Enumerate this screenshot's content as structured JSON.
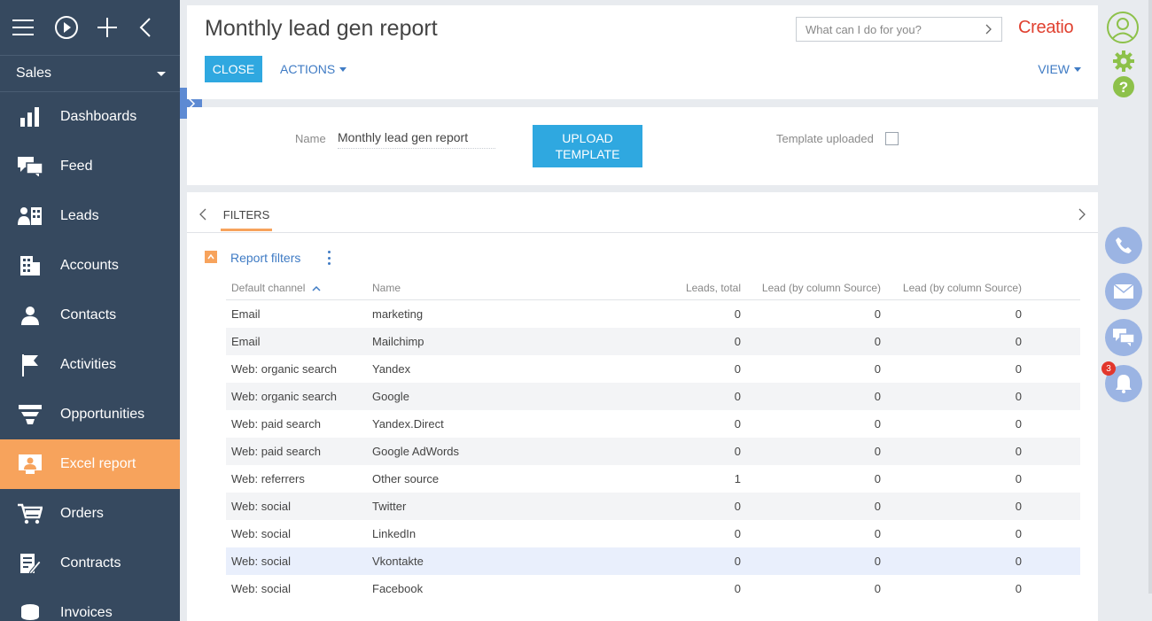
{
  "sidebar": {
    "workspace": "Sales",
    "items": [
      {
        "label": "Dashboards",
        "icon": "bar-chart-icon",
        "active": false
      },
      {
        "label": "Feed",
        "icon": "feed-icon",
        "active": false
      },
      {
        "label": "Leads",
        "icon": "leads-icon",
        "active": false
      },
      {
        "label": "Accounts",
        "icon": "accounts-icon",
        "active": false
      },
      {
        "label": "Contacts",
        "icon": "contacts-icon",
        "active": false
      },
      {
        "label": "Activities",
        "icon": "flag-icon",
        "active": false
      },
      {
        "label": "Opportunities",
        "icon": "funnel-icon",
        "active": false
      },
      {
        "label": "Excel report",
        "icon": "excel-report-icon",
        "active": true
      },
      {
        "label": "Orders",
        "icon": "cart-icon",
        "active": false
      },
      {
        "label": "Contracts",
        "icon": "contract-icon",
        "active": false
      },
      {
        "label": "Invoices",
        "icon": "invoice-icon",
        "active": false
      }
    ]
  },
  "header": {
    "title": "Monthly lead gen report",
    "close_label": "CLOSE",
    "actions_label": "ACTIONS",
    "view_label": "VIEW",
    "search_placeholder": "What can I do for you?",
    "logo": "Creatio"
  },
  "form": {
    "name_label": "Name",
    "name_value": "Monthly lead gen report",
    "upload_line1": "UPLOAD",
    "upload_line2": "TEMPLATE",
    "template_label": "Template uploaded",
    "template_checked": false
  },
  "filters": {
    "tab_label": "FILTERS",
    "group_title": "Report filters",
    "columns": [
      "Default channel",
      "Name",
      "Leads, total",
      "Lead (by column Source)",
      "Lead (by column Source)"
    ],
    "rows": [
      [
        "Email",
        "marketing",
        "0",
        "0",
        "0"
      ],
      [
        "Email",
        "Mailchimp",
        "0",
        "0",
        "0"
      ],
      [
        "Web: organic search",
        "Yandex",
        "0",
        "0",
        "0"
      ],
      [
        "Web: organic search",
        "Google",
        "0",
        "0",
        "0"
      ],
      [
        "Web: paid search",
        "Yandex.Direct",
        "0",
        "0",
        "0"
      ],
      [
        "Web: paid search",
        "Google AdWords",
        "0",
        "0",
        "0"
      ],
      [
        "Web: referrers",
        "Other source",
        "1",
        "0",
        "0"
      ],
      [
        "Web: social",
        "Twitter",
        "0",
        "0",
        "0"
      ],
      [
        "Web: social",
        "LinkedIn",
        "0",
        "0",
        "0"
      ],
      [
        "Web: social",
        "Vkontakte",
        "0",
        "0",
        "0"
      ],
      [
        "Web: social",
        "Facebook",
        "0",
        "0",
        "0"
      ]
    ]
  },
  "notifications": {
    "count": "3"
  },
  "colors": {
    "sidebar": "#36495f",
    "accent": "#f7a35c",
    "primary_button": "#2fa8e0",
    "link": "#3f7bc4"
  }
}
